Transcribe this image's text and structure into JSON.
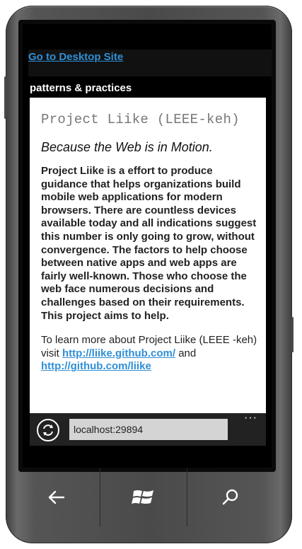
{
  "links": {
    "desktop_site": "Go to Desktop Site"
  },
  "header": {
    "brand": "patterns & practices"
  },
  "article": {
    "title": "Project Liike (LEEE-keh)",
    "tagline": "Because the Web is in Motion.",
    "body": "Project Liike is a effort to produce guidance that helps organizations build mobile web applications for modern browsers. There are countless devices available today and all indications suggest this number is only going to grow, without convergence. The factors to help choose between native apps and web apps are fairly well-known. Those who choose the web face numerous decisions and challenges based on their requirements. This project aims to help.",
    "learn_prefix": "To learn more about Project Liike (LEEE -keh) visit",
    "link1": "http://liike.github.com/",
    "learn_middle": "and",
    "link2": "http://github.com/liike"
  },
  "browser": {
    "url": "localhost:29894",
    "more_label": "···"
  },
  "nav": {
    "back_icon": "back-arrow-icon",
    "start_icon": "windows-logo-icon",
    "search_icon": "search-icon"
  },
  "colors": {
    "link": "#2f8fd6",
    "address_bg": "#222222",
    "url_field_bg": "#d4d4d4"
  }
}
